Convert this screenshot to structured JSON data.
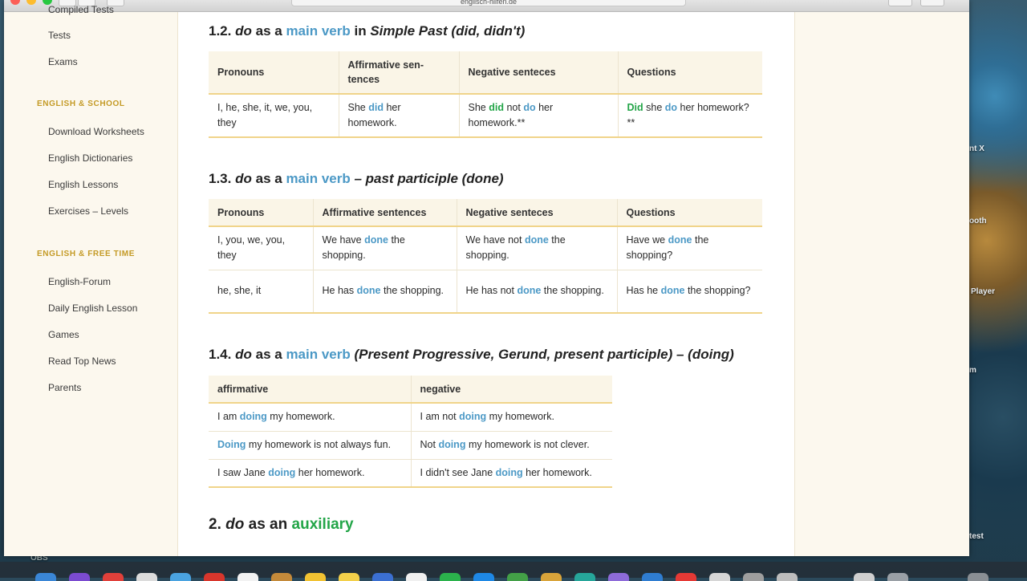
{
  "browser": {
    "address_text": "englisch-hilfen.de"
  },
  "sidebar": {
    "top_items": [
      {
        "label": "Compiled Tests"
      },
      {
        "label": "Tests"
      },
      {
        "label": "Exams"
      }
    ],
    "school_heading": "ENGLISH & SCHOOL",
    "school_items": [
      {
        "label": "Download Worksheets"
      },
      {
        "label": "English Dictionaries"
      },
      {
        "label": "English Lessons"
      },
      {
        "label": "Exercises – Levels"
      }
    ],
    "free_heading": "ENGLISH & FREE TIME",
    "free_items": [
      {
        "label": "English-Forum"
      },
      {
        "label": "Daily English Lesson"
      },
      {
        "label": "Games"
      },
      {
        "label": "Read Top News"
      },
      {
        "label": "Parents"
      }
    ]
  },
  "s12": {
    "num": "1.2.",
    "do": "do",
    "as_a": "as a",
    "main_verb": "main verb",
    "in": "in",
    "tense": "Simple Past (did, didn't)",
    "headers": [
      "Pronouns",
      "Affirmative sen­tences",
      "Negative senteces",
      "Questions"
    ],
    "row": {
      "pronouns": "I, he, she, it, we, you, they",
      "aff_a": "She",
      "aff_k": "did",
      "aff_b": "her homework.",
      "neg_a": "She",
      "neg_k1": "did",
      "neg_b": "not",
      "neg_k2": "do",
      "neg_c": "her homework.**",
      "q_k1": "Did",
      "q_a": "she",
      "q_k2": "do",
      "q_b": "her home­work?**"
    }
  },
  "s13": {
    "num": "1.3.",
    "do": "do",
    "as_a": "as a",
    "main_verb": "main verb",
    "tail": "– past participle (done)",
    "headers": [
      "Pronouns",
      "Affirmative sentences",
      "Negative senteces",
      "Questions"
    ],
    "rows": [
      {
        "pronouns": "I, you, we, you, they",
        "aff_a": "We have",
        "aff_k": "done",
        "aff_b": "the shopping.",
        "neg_a": "We have not",
        "neg_k": "done",
        "neg_b": "the shopping.",
        "q_a": "Have we",
        "q_k": "done",
        "q_b": "the shopping?"
      },
      {
        "pronouns": "he, she, it",
        "aff_a": "He has",
        "aff_k": "done",
        "aff_b": "the shopping.",
        "neg_a": "He has not",
        "neg_k": "done",
        "neg_b": "the shopping.",
        "q_a": "Has he",
        "q_k": "done",
        "q_b": "the shopping?"
      }
    ]
  },
  "s14": {
    "num": "1.4.",
    "do": "do",
    "as_a": "as a",
    "main_verb": "main verb",
    "tail": "(Present Progressive, Gerund, present participle) – (doing)",
    "headers": [
      "affirmative",
      "negative"
    ],
    "rows": [
      {
        "a_pre": "I am",
        "a_k": "doing",
        "a_post": "my homework.",
        "n_pre": "I am not",
        "n_k": "doing",
        "n_post": "my homework."
      },
      {
        "a_pre": "",
        "a_k": "Doing",
        "a_post": "my homework is not always fun.",
        "n_pre": "Not",
        "n_k": "doing",
        "n_post": "my homework is not clever."
      },
      {
        "a_pre": "I saw Jane",
        "a_k": "doing",
        "a_post": "her homework.",
        "n_pre": "I didn't see Jane",
        "n_k": "doing",
        "n_post": "her homework."
      }
    ]
  },
  "s2": {
    "num": "2.",
    "do": "do",
    "as_an": "as an",
    "auxiliary": "auxiliary"
  },
  "desktop": {
    "labels": [
      "nt X",
      "ooth",
      "Player",
      "m",
      "test",
      "OBS"
    ]
  },
  "colors": {
    "accent_blue": "#4c99c6",
    "accent_green": "#23a548",
    "sidebar_heading": "#c49a25",
    "table_rule": "#f0d48a"
  }
}
